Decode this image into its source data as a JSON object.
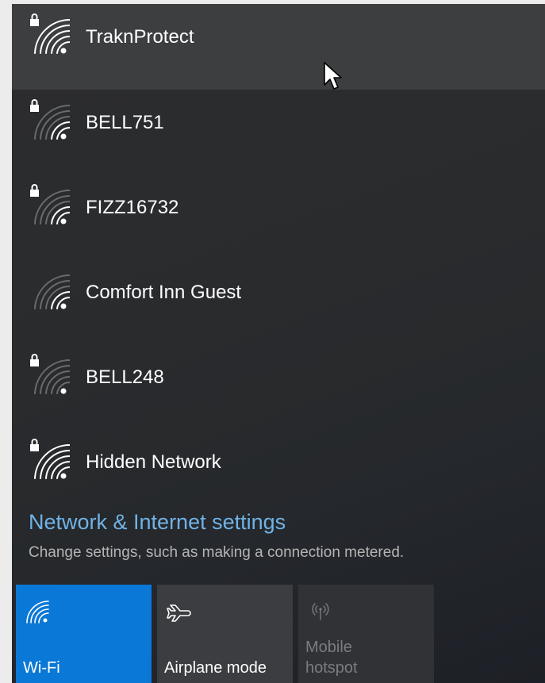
{
  "networks": [
    {
      "name": "TraknProtect",
      "secured": true,
      "signal": "full",
      "hovered": true
    },
    {
      "name": "BELL751",
      "secured": true,
      "signal": "low",
      "hovered": false
    },
    {
      "name": "FIZZ16732",
      "secured": true,
      "signal": "low",
      "hovered": false
    },
    {
      "name": "Comfort Inn Guest",
      "secured": false,
      "signal": "low",
      "hovered": false
    },
    {
      "name": "BELL248",
      "secured": true,
      "signal": "minimal",
      "hovered": false
    },
    {
      "name": "Hidden Network",
      "secured": true,
      "signal": "full",
      "hovered": false
    }
  ],
  "settings": {
    "link_label": "Network & Internet settings",
    "description": "Change settings, such as making a connection metered."
  },
  "quick_actions": {
    "wifi": {
      "label": "Wi-Fi",
      "icon": "wifi-icon",
      "active": true
    },
    "airplane": {
      "label": "Airplane mode",
      "icon": "airplane-icon",
      "active": false
    },
    "hotspot": {
      "label_line1": "Mobile",
      "label_line2": "hotspot",
      "icon": "hotspot-icon",
      "disabled": true
    }
  },
  "colors": {
    "accent": "#0a78d6",
    "link": "#6fb3e6",
    "panel_bg": "#2b2c2e",
    "hover_bg": "#3d3e40"
  }
}
